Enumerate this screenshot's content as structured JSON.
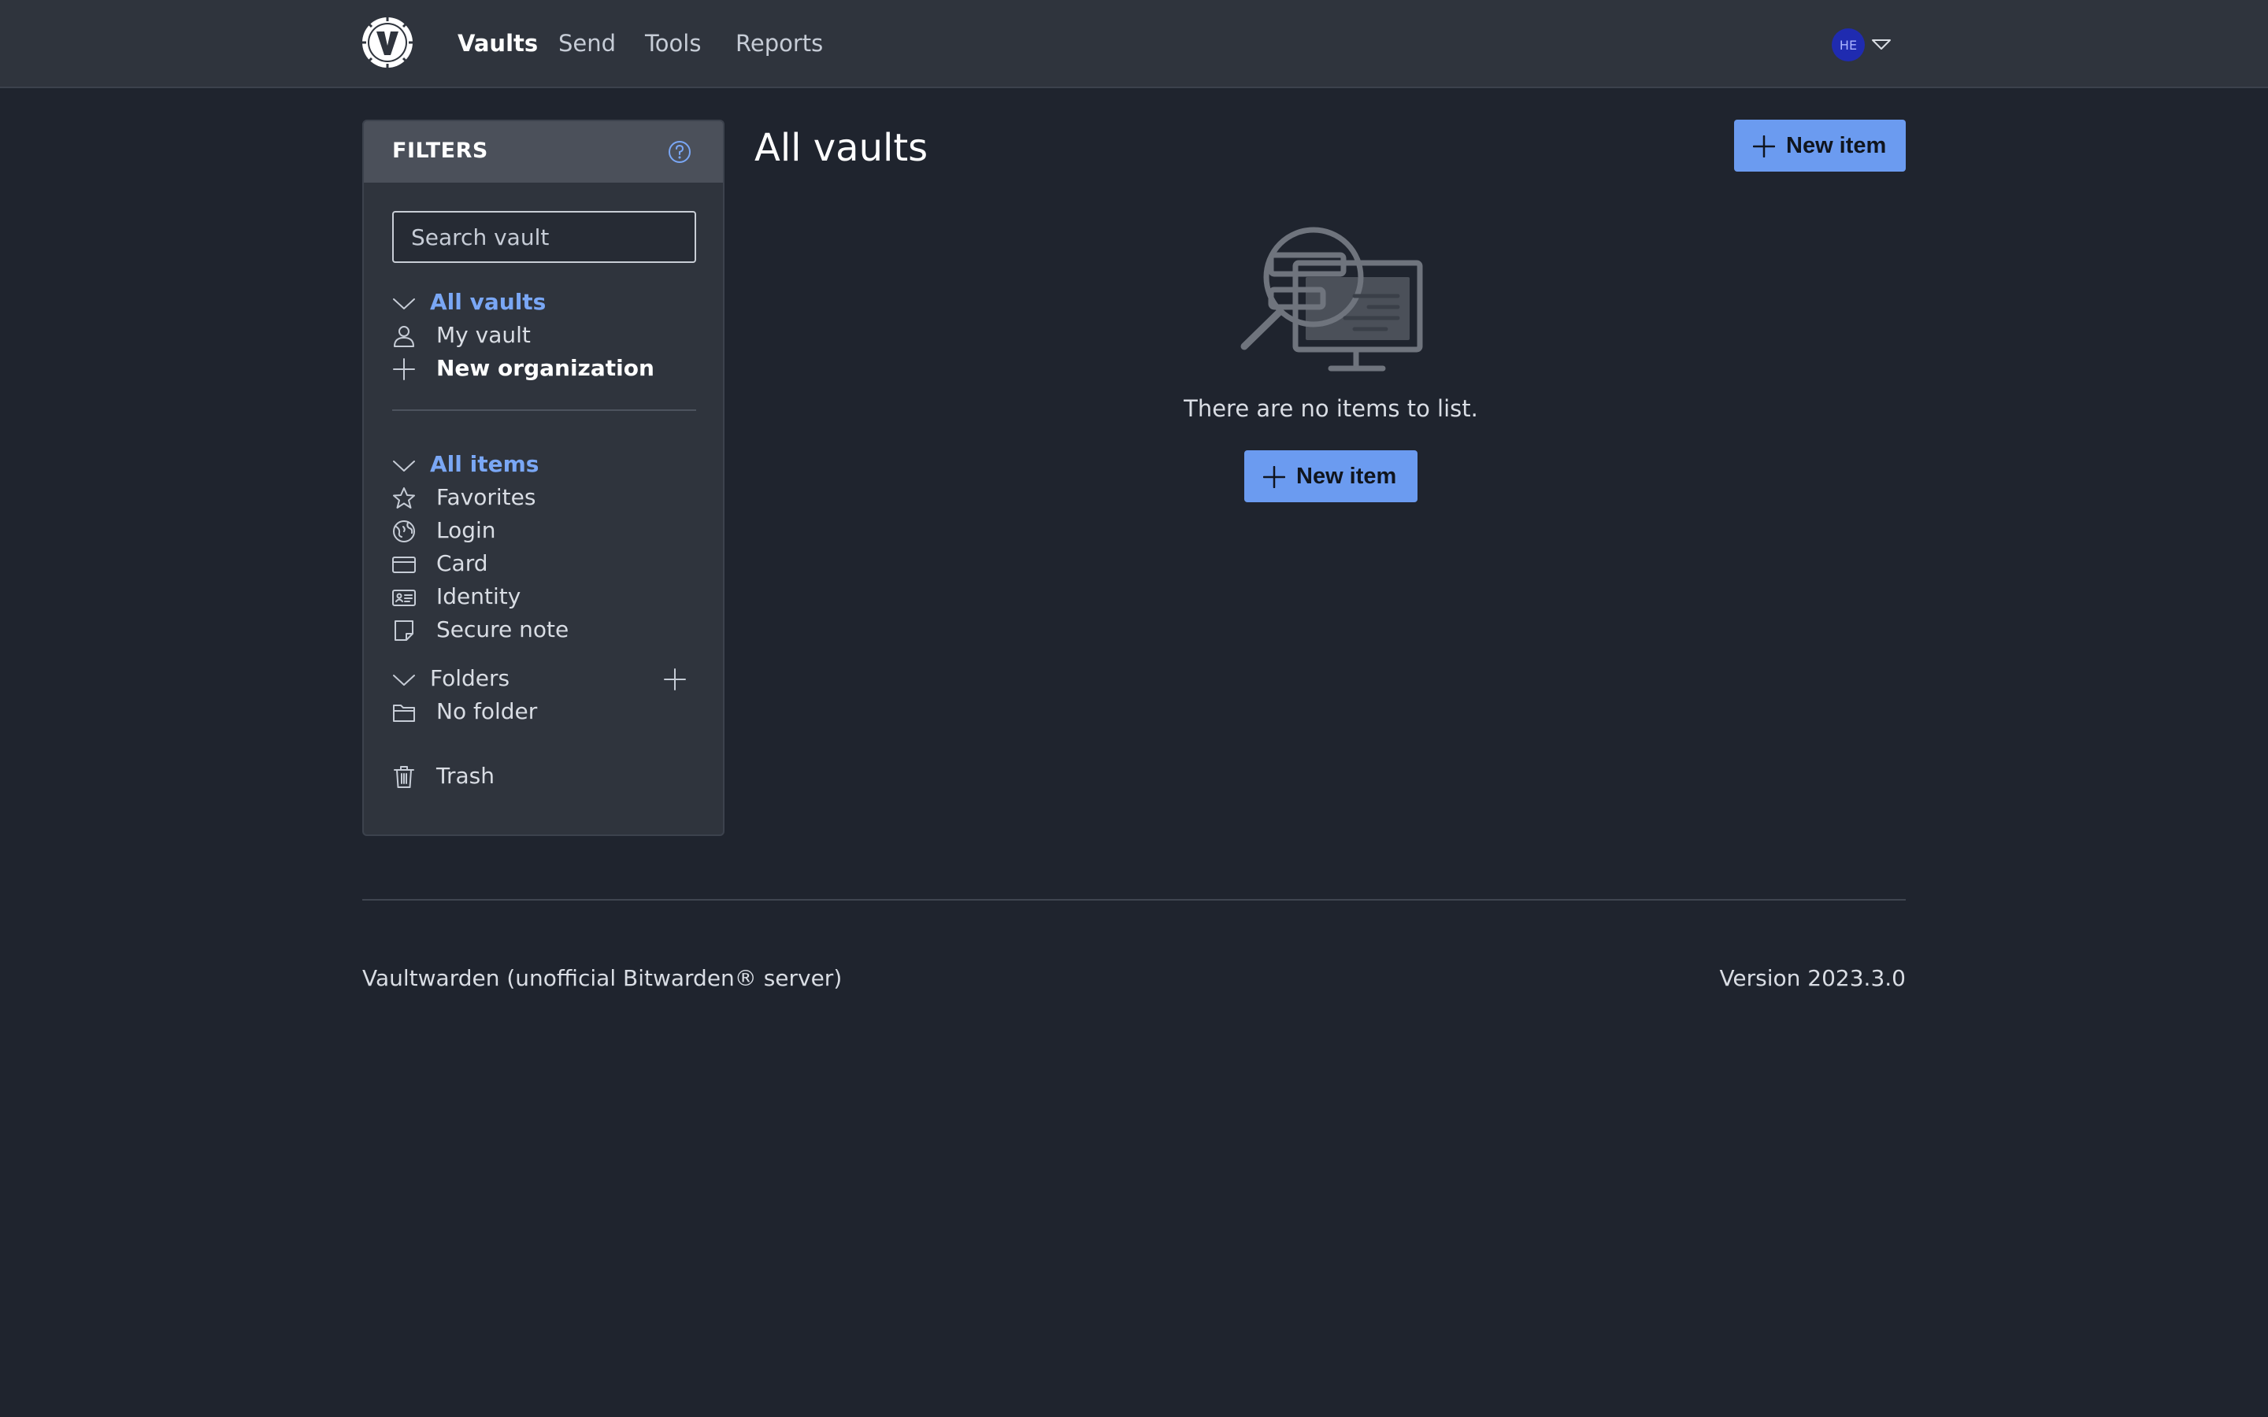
{
  "nav": {
    "links": [
      "Vaults",
      "Send",
      "Tools",
      "Reports"
    ],
    "active": "Vaults",
    "avatar_initials": "HE"
  },
  "filters": {
    "title": "FILTERS",
    "search_placeholder": "Search vault",
    "vaults": {
      "header": "All vaults",
      "items": [
        "My vault",
        "New organization"
      ]
    },
    "items": {
      "header": "All items",
      "types": [
        "Favorites",
        "Login",
        "Card",
        "Identity",
        "Secure note"
      ]
    },
    "folders": {
      "header": "Folders",
      "items": [
        "No folder"
      ]
    },
    "trash": "Trash"
  },
  "main": {
    "title": "All vaults",
    "new_item_label": "New item",
    "empty_message": "There are no items to list."
  },
  "footer": {
    "left": "Vaultwarden (unofficial Bitwarden® server)",
    "right": "Version 2023.3.0"
  },
  "colors": {
    "accent": "#6b9bf0",
    "link_active": "#7aa7f5",
    "background": "#1f242e",
    "navbar": "#2f343d"
  },
  "icons": {
    "logo": "vaultwarden-logo-icon",
    "help": "question-circle-icon",
    "chevron": "chevron-down-icon",
    "user": "user-icon",
    "plus": "plus-icon",
    "star": "star-icon",
    "globe": "globe-icon",
    "card": "credit-card-icon",
    "id": "id-card-icon",
    "note": "sticky-note-icon",
    "folder": "folder-icon",
    "trash": "trash-icon"
  }
}
